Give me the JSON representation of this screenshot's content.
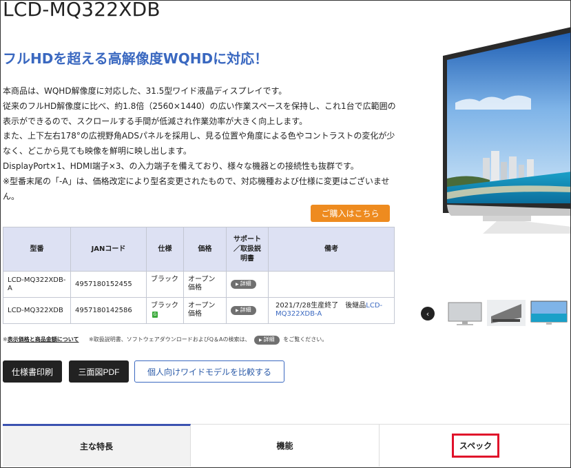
{
  "product": {
    "title": "LCD-MQ322XDB",
    "subtitle": "フルHDを超える高解像度WQHDに対応！"
  },
  "description": [
    "本商品は、WQHD解像度に対応した、31.5型ワイド液晶ディスプレイです。",
    "従来のフルHD解像度に比べ、約1.8倍（2560×1440）の広い作業スペースを保持し、これ1台で広範囲の表示ができるので、スクロールする手間が低減され作業効率が大きく向上します。",
    "また、上下左右178°の広視野角ADSパネルを採用し、見る位置や角度による色やコントラストの変化が少なく、どこから見ても映像を鮮明に映し出します。",
    "DisplayPort×1、HDMI端子×3、の入力端子を備えており、様々な機器との接続性も抜群です。",
    "※型番末尾の「-A」は、価格改定により型名変更されたもので、対応機種および仕様に変更はございません。"
  ],
  "buy_button": "ご購入はこちら",
  "table": {
    "headers": {
      "model": "型番",
      "jan": "JANコード",
      "spec": "仕様",
      "price": "価格",
      "support": "サポート／取扱説明書",
      "notes": "備考"
    },
    "rows": [
      {
        "model": "LCD-MQ322XDB-A",
        "jan": "4957180152455",
        "spec": "ブラック",
        "price": "オープン価格",
        "support": "詳細",
        "notes": "",
        "eco_badge": false
      },
      {
        "model": "LCD-MQ322XDB",
        "jan": "4957180142586",
        "spec": "ブラック",
        "eco_badge_label": "G",
        "price": "オープン価格",
        "support": "詳細",
        "notes": "2021/7/28生産終了　後継品",
        "notes_link": "LCD-MQ322XDB-A",
        "eco_badge": true
      }
    ]
  },
  "footnote": {
    "link": "表示価格と商品金額について",
    "text_before": "※取扱説明書、ソフトウェアダウンロードおよびQ＆Aの検索は、",
    "pill": "詳細",
    "text_after": "をご覧ください。",
    "prefix": "※"
  },
  "buttons": {
    "print_spec": "仕様書印刷",
    "pdf": "三面図PDF",
    "compare": "個人向けワイドモデルを比較する"
  },
  "tabs": [
    {
      "label": "主な特長",
      "active": true
    },
    {
      "label": "機能",
      "active": false
    },
    {
      "label": "スペック",
      "active": false,
      "highlighted": true
    }
  ],
  "gallery": {
    "prev_icon": "chevron-left-icon",
    "prev_glyph": "‹"
  },
  "colors": {
    "accent_blue": "#3a68c0",
    "buy_orange": "#ee8b1f",
    "table_header": "#dde1f3",
    "highlight_red": "#e0102a",
    "tab_active_border": "#3a52b0"
  }
}
